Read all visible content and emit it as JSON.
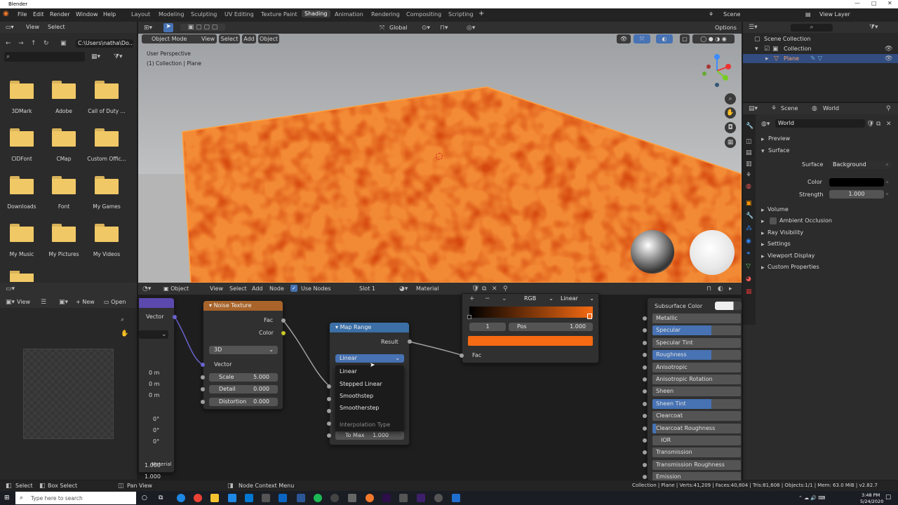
{
  "window": {
    "title": "Blender"
  },
  "menu": {
    "items": [
      "File",
      "Edit",
      "Render",
      "Window",
      "Help"
    ]
  },
  "workspaces": [
    "Layout",
    "Modeling",
    "Sculpting",
    "UV Editing",
    "Texture Paint",
    "Shading",
    "Animation",
    "Rendering",
    "Compositing",
    "Scripting"
  ],
  "top_right": {
    "scene": "Scene",
    "view_layer": "View Layer"
  },
  "filebrowser": {
    "view": "View",
    "select": "Select",
    "path": "C:\\Users\\natha\\Do...",
    "folders": [
      {
        "name": "3DMark"
      },
      {
        "name": "Adobe"
      },
      {
        "name": "Call of Duty ..."
      },
      {
        "name": "CIDFont"
      },
      {
        "name": "CMap"
      },
      {
        "name": "Custom Offic..."
      },
      {
        "name": "Downloads"
      },
      {
        "name": "Font"
      },
      {
        "name": "My Games"
      },
      {
        "name": "My Music"
      },
      {
        "name": "My Pictures"
      },
      {
        "name": "My Videos"
      }
    ]
  },
  "viewport": {
    "transform": "Global",
    "mode": "Object Mode",
    "menus": [
      "View",
      "Select",
      "Add",
      "Object"
    ],
    "options": "Options",
    "perspective": "User Perspective",
    "collection": "(1) Collection | Plane"
  },
  "outliner": {
    "scene_collection": "Scene Collection",
    "collection": "Collection",
    "plane": "Plane"
  },
  "properties": {
    "scene": "Scene",
    "world": "World",
    "world_name": "World",
    "preview": "Preview",
    "surface": "Surface",
    "surface_label": "Surface",
    "surface_value": "Background",
    "color_label": "Color",
    "strength_label": "Strength",
    "strength_value": "1.000",
    "sections": [
      "Volume",
      "Ambient Occlusion",
      "Ray Visibility",
      "Settings",
      "Viewport Display",
      "Custom Properties"
    ]
  },
  "image_editor": {
    "view": "View",
    "new": "New",
    "open": "Open"
  },
  "node_editor": {
    "object": "Object",
    "menus": [
      "View",
      "Select",
      "Add",
      "Node"
    ],
    "use_nodes": "Use Nodes",
    "slot": "Slot 1",
    "material": "Material",
    "left_node": {
      "vector": "Vector",
      "values": [
        "0 m",
        "0 m",
        "0 m",
        "0°",
        "0°",
        "0°",
        "1.000",
        "1.000"
      ],
      "material_overlay": "Material"
    },
    "noise": {
      "title": "Noise Texture",
      "fac": "Fac",
      "color": "Color",
      "dim": "3D",
      "vector": "Vector",
      "scale_label": "Scale",
      "scale_value": "5.000",
      "detail_label": "Detail",
      "detail_value": "0.000",
      "distortion_label": "Distortion",
      "distortion_value": "0.000"
    },
    "map_range": {
      "title": "Map Range",
      "result": "Result",
      "interp": "Linear",
      "to_max_label": "To Max",
      "to_max_value": "1.000"
    },
    "dropdown": {
      "options": [
        "Linear",
        "Stepped Linear",
        "Smoothstep",
        "Smootherstep"
      ],
      "footer": "Interpolation Type"
    },
    "color_ramp": {
      "color_mode": "RGB",
      "interp": "Linear",
      "index": "1",
      "pos_label": "Pos",
      "pos_value": "1.000",
      "fac": "Fac"
    },
    "bsdf": {
      "subsurface_color": "Subsurface Color",
      "rows": [
        {
          "label": "Metallic",
          "fill": 0
        },
        {
          "label": "Specular",
          "fill": 0.5
        },
        {
          "label": "Specular Tint",
          "fill": 0
        },
        {
          "label": "Roughness",
          "fill": 0.5
        },
        {
          "label": "Anisotropic",
          "fill": 0
        },
        {
          "label": "Anisotropic Rotation",
          "fill": 0
        },
        {
          "label": "Sheen",
          "fill": 0
        },
        {
          "label": "Sheen Tint",
          "fill": 0.5
        },
        {
          "label": "Clearcoat",
          "fill": 0
        },
        {
          "label": "Clearcoat Roughness",
          "fill": 0.03
        },
        {
          "label": "IOR",
          "fill": 0
        },
        {
          "label": "Transmission",
          "fill": 0
        },
        {
          "label": "Transmission Roughness",
          "fill": 0
        },
        {
          "label": "Emission",
          "fill": 0
        }
      ]
    }
  },
  "statusbar": {
    "select": "Select",
    "box_select": "Box Select",
    "pan_view": "Pan View",
    "context_menu": "Node Context Menu",
    "stats": "Collection | Plane | Verts:41,209 | Faces:40,804 | Tris:81,608 | Objects:1/1 | Mem: 63.0 MiB | v2.82.7"
  },
  "taskbar": {
    "search": "Type here to search",
    "time": "3:48 PM",
    "date": "5/24/2020"
  },
  "colors": {
    "accent": "#4772b3",
    "orange": "#f56a12",
    "bg": "#1d1d1d"
  }
}
